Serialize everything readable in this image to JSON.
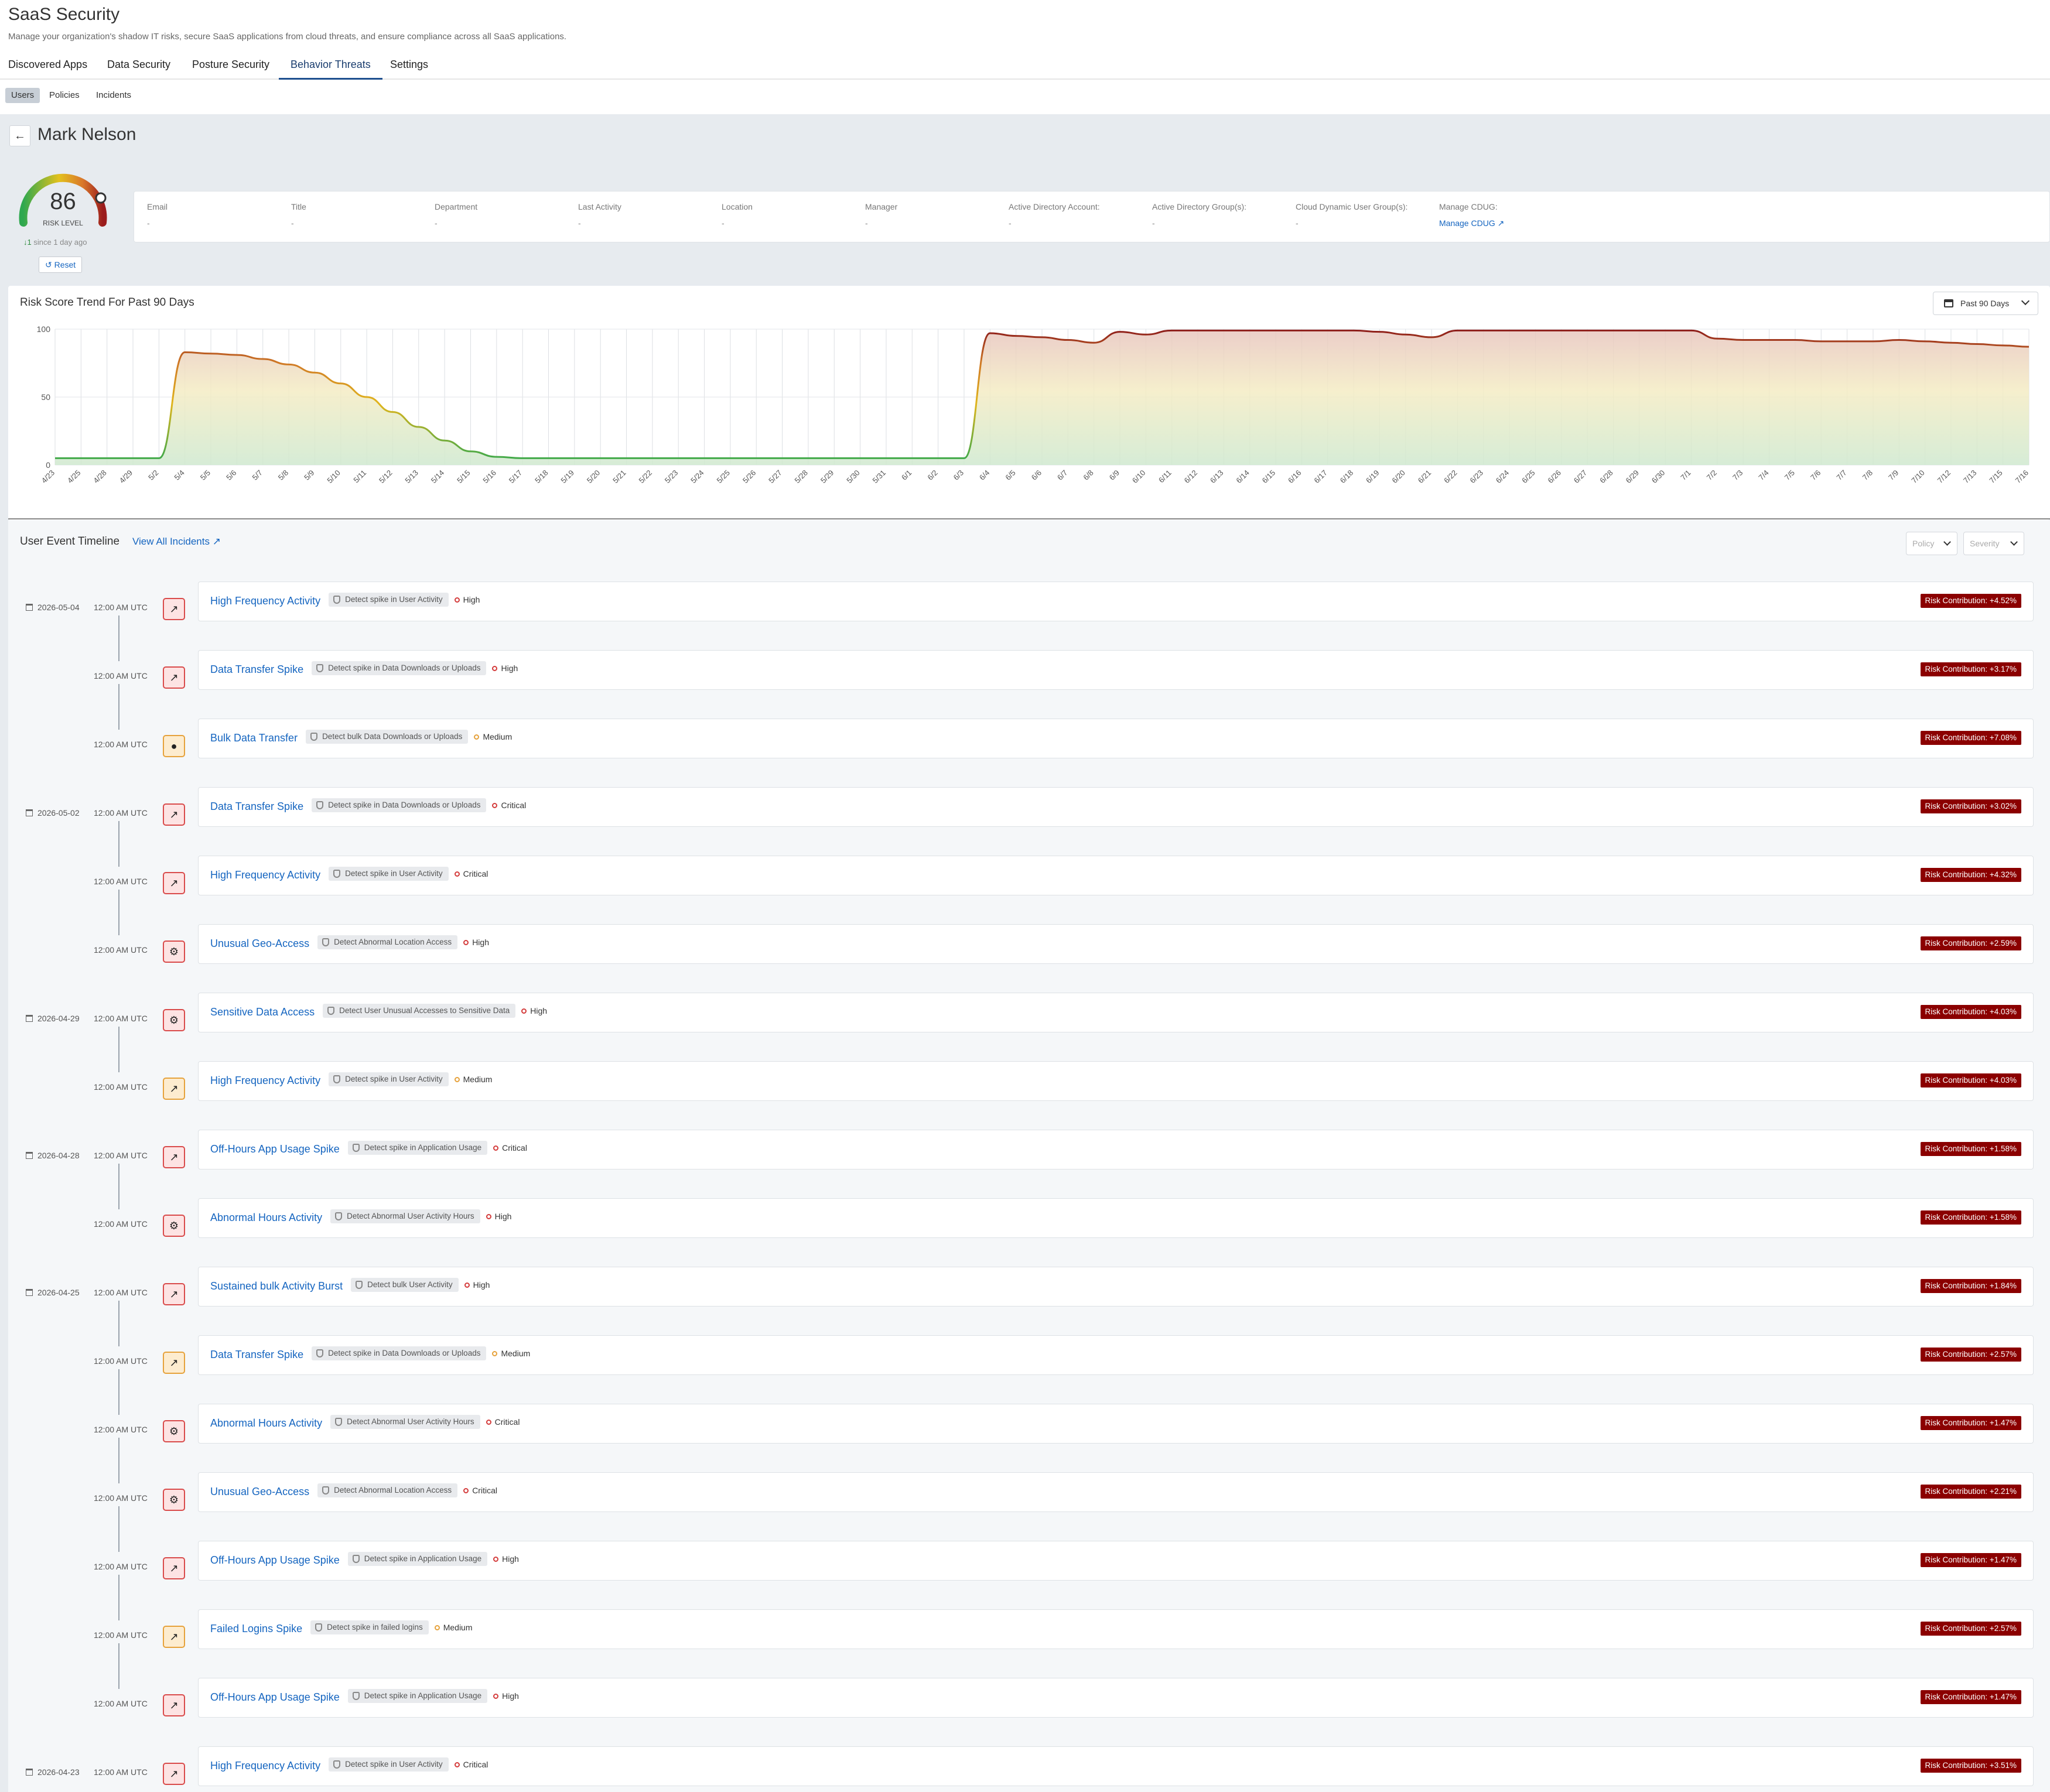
{
  "app": {
    "title": "SaaS Security",
    "subtitle": "Manage your organization's shadow IT risks, secure SaaS applications from cloud threats, and ensure compliance across all SaaS applications."
  },
  "tabs": [
    "Discovered Apps",
    "Data Security",
    "Posture Security",
    "Behavior Threats",
    "Settings"
  ],
  "active_tab": "Behavior Threats",
  "subtabs": [
    "Users",
    "Policies",
    "Incidents"
  ],
  "active_subtab": "Users",
  "user": {
    "name": "Mark Nelson",
    "risk_score": "86",
    "risk_label": "RISK LEVEL",
    "change": "1",
    "change_text": "since 1 day ago",
    "reset_label": "Reset"
  },
  "info": [
    {
      "label": "Email",
      "value": "-"
    },
    {
      "label": "Title",
      "value": "-"
    },
    {
      "label": "Department",
      "value": "-"
    },
    {
      "label": "Last Activity",
      "value": "-"
    },
    {
      "label": "Location",
      "value": "-"
    },
    {
      "label": "Manager",
      "value": "-"
    },
    {
      "label": "Active Directory Account:",
      "value": "-"
    },
    {
      "label": "Active Directory Group(s):",
      "value": "-"
    },
    {
      "label": "Cloud Dynamic User Group(s):",
      "value": "-"
    },
    {
      "label": "Manage CDUG:",
      "link": "Manage CDUG"
    }
  ],
  "chart": {
    "title": "Risk Score Trend For Past 90 Days",
    "range_label": "Past 90 Days"
  },
  "chart_data": {
    "type": "area",
    "ylim": [
      0,
      100
    ],
    "yticks": [
      0,
      50,
      100
    ],
    "x": [
      "4/23",
      "4/25",
      "4/28",
      "4/29",
      "5/2",
      "5/4",
      "5/5",
      "5/6",
      "5/7",
      "5/8",
      "5/9",
      "5/10",
      "5/11",
      "5/12",
      "5/13",
      "5/14",
      "5/15",
      "5/16",
      "5/17",
      "5/18",
      "5/19",
      "5/20",
      "5/21",
      "5/22",
      "5/23",
      "5/24",
      "5/25",
      "5/26",
      "5/27",
      "5/28",
      "5/29",
      "5/30",
      "5/31",
      "6/1",
      "6/2",
      "6/3",
      "6/4",
      "6/5",
      "6/6",
      "6/7",
      "6/8",
      "6/9",
      "6/10",
      "6/11",
      "6/12",
      "6/13",
      "6/14",
      "6/15",
      "6/16",
      "6/17",
      "6/18",
      "6/19",
      "6/20",
      "6/21",
      "6/22",
      "6/23",
      "6/24",
      "6/25",
      "6/26",
      "6/27",
      "6/28",
      "6/29",
      "6/30",
      "7/1",
      "7/2",
      "7/3",
      "7/4",
      "7/5",
      "7/6",
      "7/7",
      "7/8",
      "7/9",
      "7/10",
      "7/12",
      "7/13",
      "7/15",
      "7/16"
    ],
    "values": [
      5,
      5,
      5,
      5,
      5,
      83,
      82,
      81,
      78,
      74,
      68,
      60,
      50,
      39,
      28,
      18,
      10,
      6,
      5,
      5,
      5,
      5,
      5,
      5,
      5,
      5,
      5,
      5,
      5,
      5,
      5,
      5,
      5,
      5,
      5,
      5,
      97,
      95,
      94,
      92,
      90,
      98,
      96,
      99,
      99,
      99,
      99,
      99,
      99,
      99,
      99,
      98,
      96,
      94,
      99,
      99,
      99,
      99,
      99,
      99,
      99,
      99,
      99,
      99,
      93,
      92,
      92,
      92,
      91,
      91,
      91,
      92,
      91,
      90,
      89,
      88,
      87
    ]
  },
  "timeline": {
    "title": "User Event Timeline",
    "link": "View All Incidents",
    "filter_policy": "Policy",
    "filter_severity": "Severity",
    "events": [
      {
        "date": "2026-05-04",
        "time": "12:00 AM UTC",
        "icon": "chart",
        "name": "High Frequency Activity",
        "policy": "Detect spike in User Activity",
        "severity": "High",
        "risk": "Risk Contribution: +4.52%"
      },
      {
        "date": "",
        "time": "12:00 AM UTC",
        "icon": "chart",
        "name": "Data Transfer Spike",
        "policy": "Detect spike in Data Downloads or Uploads",
        "severity": "High",
        "risk": "Risk Contribution: +3.17%"
      },
      {
        "date": "",
        "time": "12:00 AM UTC",
        "icon": "dot",
        "name": "Bulk Data Transfer",
        "policy": "Detect bulk Data Downloads or Uploads",
        "severity": "Medium",
        "risk": "Risk Contribution: +7.08%"
      },
      {
        "date": "2026-05-02",
        "time": "12:00 AM UTC",
        "icon": "chart",
        "name": "Data Transfer Spike",
        "policy": "Detect spike in Data Downloads or Uploads",
        "severity": "Critical",
        "risk": "Risk Contribution: +3.02%"
      },
      {
        "date": "",
        "time": "12:00 AM UTC",
        "icon": "chart",
        "name": "High Frequency Activity",
        "policy": "Detect spike in User Activity",
        "severity": "Critical",
        "risk": "Risk Contribution: +4.32%"
      },
      {
        "date": "",
        "time": "12:00 AM UTC",
        "icon": "bug",
        "name": "Unusual Geo-Access",
        "policy": "Detect Abnormal Location Access",
        "severity": "High",
        "risk": "Risk Contribution: +2.59%"
      },
      {
        "date": "2026-04-29",
        "time": "12:00 AM UTC",
        "icon": "bug",
        "name": "Sensitive Data Access",
        "policy": "Detect User Unusual Accesses to Sensitive Data",
        "severity": "High",
        "risk": "Risk Contribution: +4.03%"
      },
      {
        "date": "",
        "time": "12:00 AM UTC",
        "icon": "chart",
        "name": "High Frequency Activity",
        "policy": "Detect spike in User Activity",
        "severity": "Medium",
        "risk": "Risk Contribution: +4.03%"
      },
      {
        "date": "2026-04-28",
        "time": "12:00 AM UTC",
        "icon": "chart",
        "name": "Off-Hours App Usage Spike",
        "policy": "Detect spike in Application Usage",
        "severity": "Critical",
        "risk": "Risk Contribution: +1.58%"
      },
      {
        "date": "",
        "time": "12:00 AM UTC",
        "icon": "bug",
        "name": "Abnormal Hours Activity",
        "policy": "Detect Abnormal User Activity Hours",
        "severity": "High",
        "risk": "Risk Contribution: +1.58%"
      },
      {
        "date": "2026-04-25",
        "time": "12:00 AM UTC",
        "icon": "chart",
        "name": "Sustained bulk Activity Burst",
        "policy": "Detect bulk User Activity",
        "severity": "High",
        "risk": "Risk Contribution: +1.84%"
      },
      {
        "date": "",
        "time": "12:00 AM UTC",
        "icon": "chart",
        "name": "Data Transfer Spike",
        "policy": "Detect spike in Data Downloads or Uploads",
        "severity": "Medium",
        "risk": "Risk Contribution: +2.57%"
      },
      {
        "date": "",
        "time": "12:00 AM UTC",
        "icon": "bug",
        "name": "Abnormal Hours Activity",
        "policy": "Detect Abnormal User Activity Hours",
        "severity": "Critical",
        "risk": "Risk Contribution: +1.47%"
      },
      {
        "date": "",
        "time": "12:00 AM UTC",
        "icon": "bug",
        "name": "Unusual Geo-Access",
        "policy": "Detect Abnormal Location Access",
        "severity": "Critical",
        "risk": "Risk Contribution: +2.21%"
      },
      {
        "date": "",
        "time": "12:00 AM UTC",
        "icon": "chart",
        "name": "Off-Hours App Usage Spike",
        "policy": "Detect spike in Application Usage",
        "severity": "High",
        "risk": "Risk Contribution: +1.47%"
      },
      {
        "date": "",
        "time": "12:00 AM UTC",
        "icon": "chart",
        "name": "Failed Logins Spike",
        "policy": "Detect spike in failed logins",
        "severity": "Medium",
        "risk": "Risk Contribution: +2.57%"
      },
      {
        "date": "",
        "time": "12:00 AM UTC",
        "icon": "chart",
        "name": "Off-Hours App Usage Spike",
        "policy": "Detect spike in Application Usage",
        "severity": "High",
        "risk": "Risk Contribution: +1.47%"
      },
      {
        "date": "2026-04-23",
        "time": "12:00 AM UTC",
        "icon": "chart",
        "name": "High Frequency Activity",
        "policy": "Detect spike in User Activity",
        "severity": "Critical",
        "risk": "Risk Contribution: +3.51%"
      }
    ]
  }
}
